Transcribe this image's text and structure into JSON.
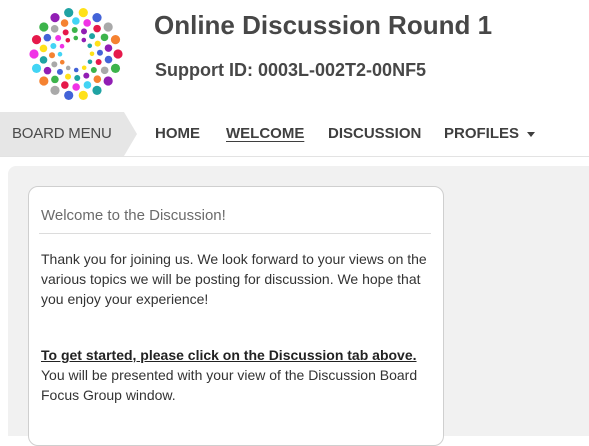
{
  "header": {
    "title": "Online Discussion Round 1",
    "support_id": "Support ID: 0003L-002T2-00NF5",
    "logo_icon": "dotted-starburst-logo"
  },
  "nav": {
    "board_menu": "BOARD MENU",
    "items": [
      {
        "label": "HOME",
        "active": false
      },
      {
        "label": "WELCOME",
        "active": true
      },
      {
        "label": "DISCUSSION",
        "active": false
      },
      {
        "label": "PROFILES",
        "active": false,
        "has_dropdown": true
      }
    ]
  },
  "panel": {
    "title": "Welcome to the Discussion!",
    "intro": "Thank you for joining us. We look forward to your views on the various topics we will be posting for discussion. We hope that you enjoy your experience!",
    "cta_link": "To get started, please click on the Discussion tab above.",
    "cta_rest": " You will be presented with your view of the Discussion Board Focus Group window."
  },
  "colors": {
    "background": "#ffffff",
    "nav_breadcrumb_bg": "#e6e6e6",
    "content_bg": "#f1f1f1",
    "text": "#474747"
  }
}
